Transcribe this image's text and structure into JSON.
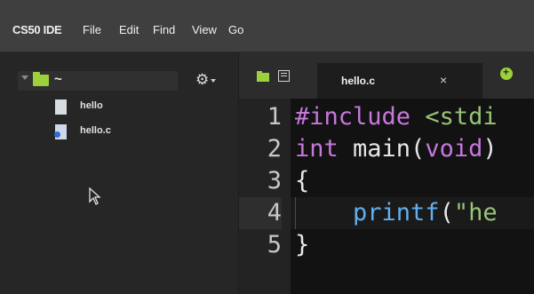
{
  "menubar": {
    "brand": "CS50 IDE",
    "items": [
      "File",
      "Edit",
      "Find",
      "View",
      "Go"
    ]
  },
  "sidebar": {
    "root_label": "~",
    "files": [
      {
        "name": "hello",
        "icon": "file-icon"
      },
      {
        "name": "hello.c",
        "icon": "c-file-icon"
      }
    ]
  },
  "tabs": {
    "active": {
      "label": "hello.c",
      "close": "×"
    }
  },
  "editor": {
    "line_numbers": [
      "1",
      "2",
      "3",
      "4",
      "5"
    ],
    "lines": [
      [
        {
          "t": "#include",
          "c": "pp"
        },
        {
          "t": " ",
          "c": "plain"
        },
        {
          "t": "<stdi",
          "c": "str"
        }
      ],
      [
        {
          "t": "int",
          "c": "kw"
        },
        {
          "t": " main(",
          "c": "plain"
        },
        {
          "t": "void",
          "c": "kw"
        },
        {
          "t": ")",
          "c": "plain"
        }
      ],
      [
        {
          "t": "{",
          "c": "plain"
        }
      ],
      [
        {
          "t": "    ",
          "c": "plain"
        },
        {
          "t": "printf",
          "c": "fn"
        },
        {
          "t": "(",
          "c": "plain"
        },
        {
          "t": "\"he",
          "c": "str"
        }
      ],
      [
        {
          "t": "}",
          "c": "plain"
        }
      ]
    ],
    "current_line": 4
  },
  "colors": {
    "accent_green": "#9cd13a",
    "keyword": "#c678dd",
    "string": "#98c379",
    "function": "#61afef"
  }
}
